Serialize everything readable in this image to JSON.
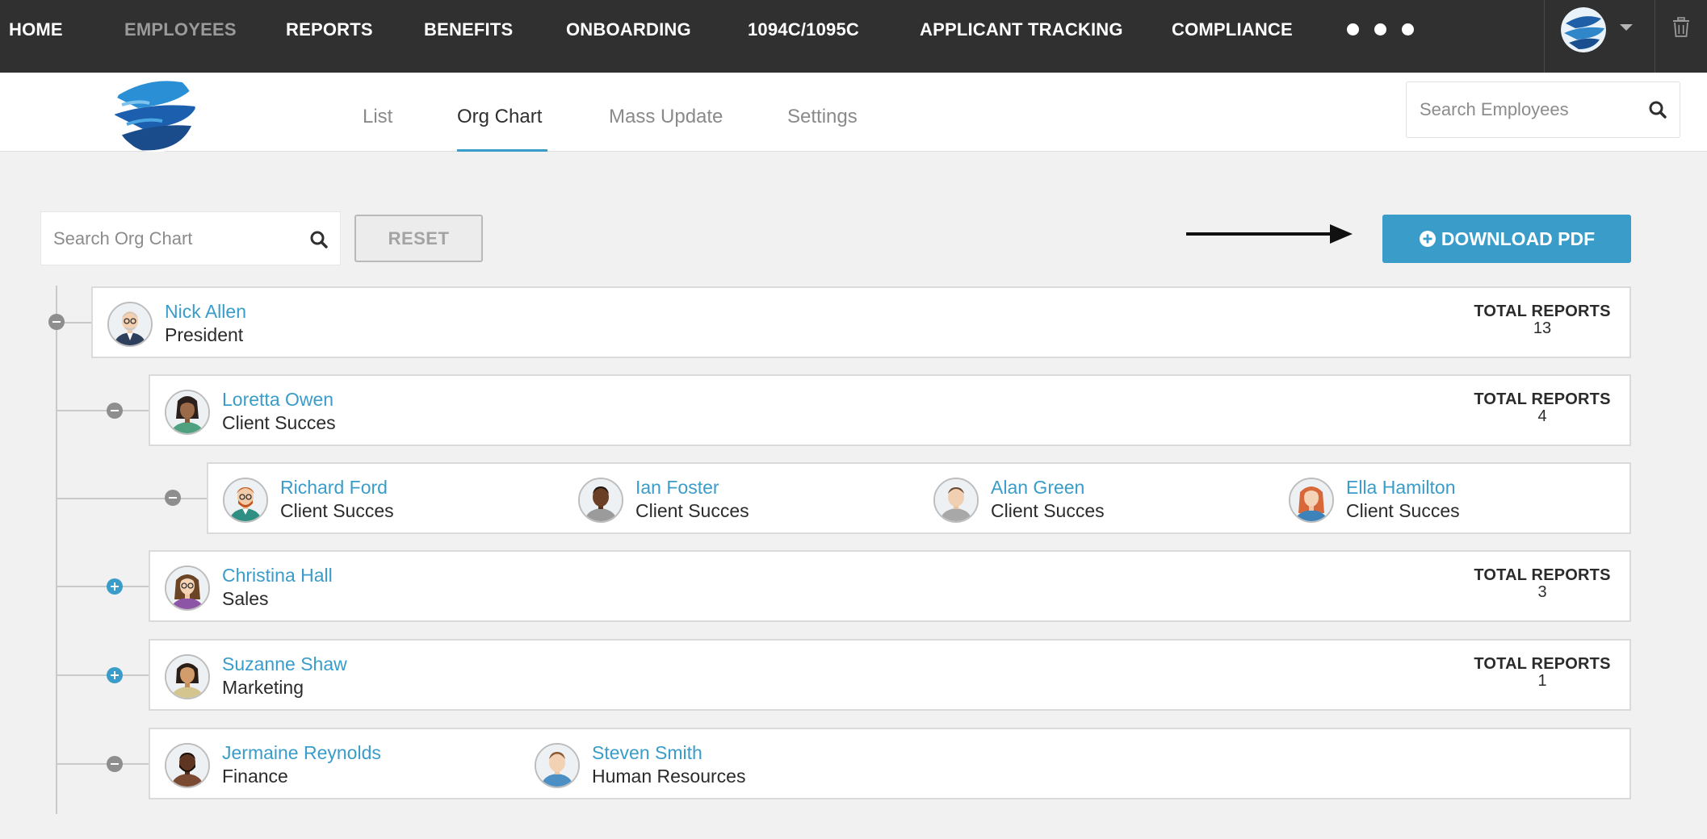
{
  "topnav": {
    "items": [
      "HOME",
      "EMPLOYEES",
      "REPORTS",
      "BENEFITS",
      "ONBOARDING",
      "1094C/1095C",
      "APPLICANT TRACKING",
      "COMPLIANCE"
    ],
    "active": "EMPLOYEES"
  },
  "subnav": {
    "tabs": [
      "List",
      "Org Chart",
      "Mass Update",
      "Settings"
    ],
    "active_tab": "Org Chart",
    "search_placeholder": "Search Employees"
  },
  "toolbar": {
    "org_search_placeholder": "Search Org Chart",
    "reset_label": "RESET",
    "download_label": "DOWNLOAD PDF"
  },
  "colors": {
    "accent": "#3a9cc9",
    "topnav_bg": "#303030",
    "page_bg": "#f1f1f1"
  },
  "org": {
    "total_reports_label": "TOTAL REPORTS",
    "president": {
      "name": "Nick Allen",
      "title": "President",
      "total_reports": "13"
    },
    "loretta": {
      "name": "Loretta Owen",
      "title": "Client Succes",
      "total_reports": "4"
    },
    "loretta_team": [
      {
        "name": "Richard Ford",
        "title": "Client Succes"
      },
      {
        "name": "Ian Foster",
        "title": "Client Succes"
      },
      {
        "name": "Alan Green",
        "title": "Client Succes"
      },
      {
        "name": "Ella Hamilton",
        "title": "Client Succes"
      }
    ],
    "christina": {
      "name": "Christina Hall",
      "title": "Sales",
      "total_reports": "3"
    },
    "suzanne": {
      "name": "Suzanne Shaw",
      "title": "Marketing",
      "total_reports": "1"
    },
    "others": [
      {
        "name": "Jermaine Reynolds",
        "title": "Finance"
      },
      {
        "name": "Steven Smith",
        "title": "Human Resources"
      }
    ]
  }
}
